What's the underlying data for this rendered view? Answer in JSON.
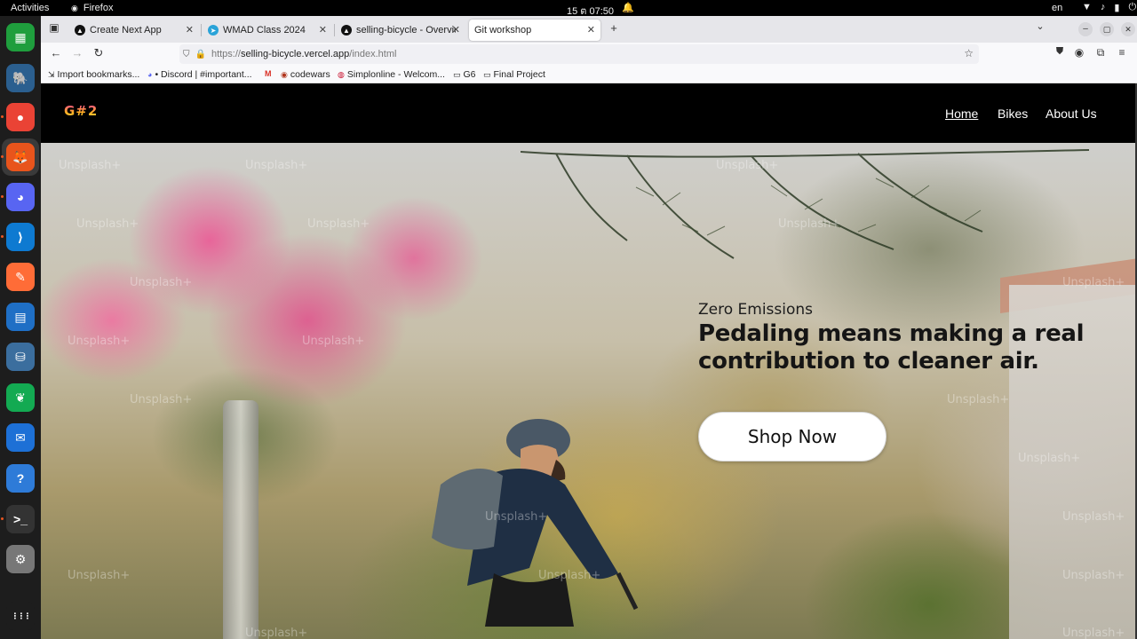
{
  "topbar": {
    "activities": "Activities",
    "app_name": "Firefox",
    "clock": "15 ต 07:50",
    "lang": "en"
  },
  "dock": {
    "apps": [
      {
        "name": "libreoffice-calc",
        "glyph": "▦",
        "color": "#1f9e3d"
      },
      {
        "name": "pgadmin",
        "glyph": "🐘",
        "color": "#2b5f8f"
      },
      {
        "name": "chrome",
        "glyph": "●",
        "color": "#ea4335"
      },
      {
        "name": "firefox",
        "glyph": "🦊",
        "color": "#e8541c"
      },
      {
        "name": "discord",
        "glyph": "◕",
        "color": "#5865f2"
      },
      {
        "name": "vscode",
        "glyph": "⟩",
        "color": "#0e7ad1"
      },
      {
        "name": "postman",
        "glyph": "✎",
        "color": "#ff6c37"
      },
      {
        "name": "libreoffice-writer",
        "glyph": "▤",
        "color": "#1f6fc5"
      },
      {
        "name": "mysql-workbench",
        "glyph": "⛁",
        "color": "#3b6e9e"
      },
      {
        "name": "mongodb-compass",
        "glyph": "❦",
        "color": "#13aa52"
      },
      {
        "name": "thunderbird",
        "glyph": "✉",
        "color": "#1d70d6"
      },
      {
        "name": "help",
        "glyph": "?",
        "color": "#2e7bd8"
      },
      {
        "name": "terminal",
        "glyph": ">_",
        "color": "#333333"
      },
      {
        "name": "settings",
        "glyph": "⚙",
        "color": "#777777"
      },
      {
        "name": "show-apps",
        "glyph": "⋮⋮⋮",
        "color": "#1d1d1d"
      }
    ]
  },
  "tabs": [
    {
      "label": "Create Next App",
      "favicon": "▲",
      "favicon_color": "#111111"
    },
    {
      "label": "WMAD Class 2024",
      "favicon": "➤",
      "favicon_color": "#2aa3d8"
    },
    {
      "label": "selling-bicycle - Overview",
      "favicon": "▲",
      "favicon_color": "#111111"
    },
    {
      "label": "Git workshop",
      "favicon": "",
      "favicon_color": ""
    }
  ],
  "urlbar": {
    "scheme": "https://",
    "host": "selling-bicycle.vercel.app",
    "path": "/index.html"
  },
  "bookmarks": [
    {
      "label": "Import bookmarks...",
      "icon": "⇲"
    },
    {
      "label": "• Discord | #important...",
      "icon": "◕"
    },
    {
      "label": "",
      "icon": "M"
    },
    {
      "label": "codewars",
      "icon": "◉"
    },
    {
      "label": "Simplonline - Welcom...",
      "icon": "◍"
    },
    {
      "label": "G6",
      "icon": "▭"
    },
    {
      "label": "Final Project",
      "icon": "▭"
    }
  ],
  "site": {
    "logo": "G#2",
    "nav": {
      "home": "Home",
      "bikes": "Bikes",
      "about": "About Us"
    },
    "hero": {
      "kicker": "Zero Emissions",
      "title_line1": "Pedaling means making a real",
      "title_line2": "contribution to cleaner air.",
      "cta": "Shop Now"
    },
    "watermark": "Unsplash+"
  }
}
